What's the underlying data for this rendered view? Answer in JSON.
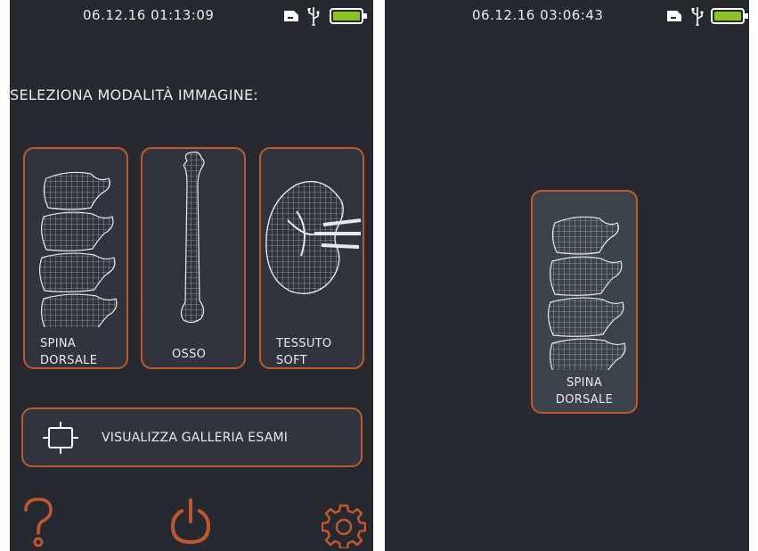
{
  "left_screen": {
    "status": {
      "datetime": "06.12.16  01:13:09",
      "icons": [
        "sd-card-icon",
        "usb-icon",
        "battery-icon"
      ]
    },
    "heading": "SELEZIONA MODALITÀ IMMAGINE:",
    "modes": [
      {
        "label": "SPINA\nDORSALE",
        "icon": "spine-icon"
      },
      {
        "label": "OSSO",
        "icon": "bone-icon"
      },
      {
        "label": "TESSUTO\nSOFT",
        "icon": "kidney-icon"
      }
    ],
    "gallery_button": {
      "label": "VISUALIZZA GALLERIA ESAMI",
      "icon": "gallery-frame-icon"
    },
    "bottom_bar": {
      "icons": [
        "help-icon",
        "power-icon",
        "settings-icon"
      ]
    }
  },
  "right_screen": {
    "status": {
      "datetime": "06.12.16  03:06:43",
      "icons": [
        "sd-card-icon",
        "usb-icon",
        "battery-icon"
      ]
    },
    "selected_mode": {
      "label": "SPINA\nDORSALE",
      "icon": "spine-icon"
    }
  },
  "colors": {
    "background": "#262a30",
    "accent": "#c2582a",
    "card_fill": "#30353d",
    "battery": "#8ec21f",
    "text": "#e8eaec"
  }
}
